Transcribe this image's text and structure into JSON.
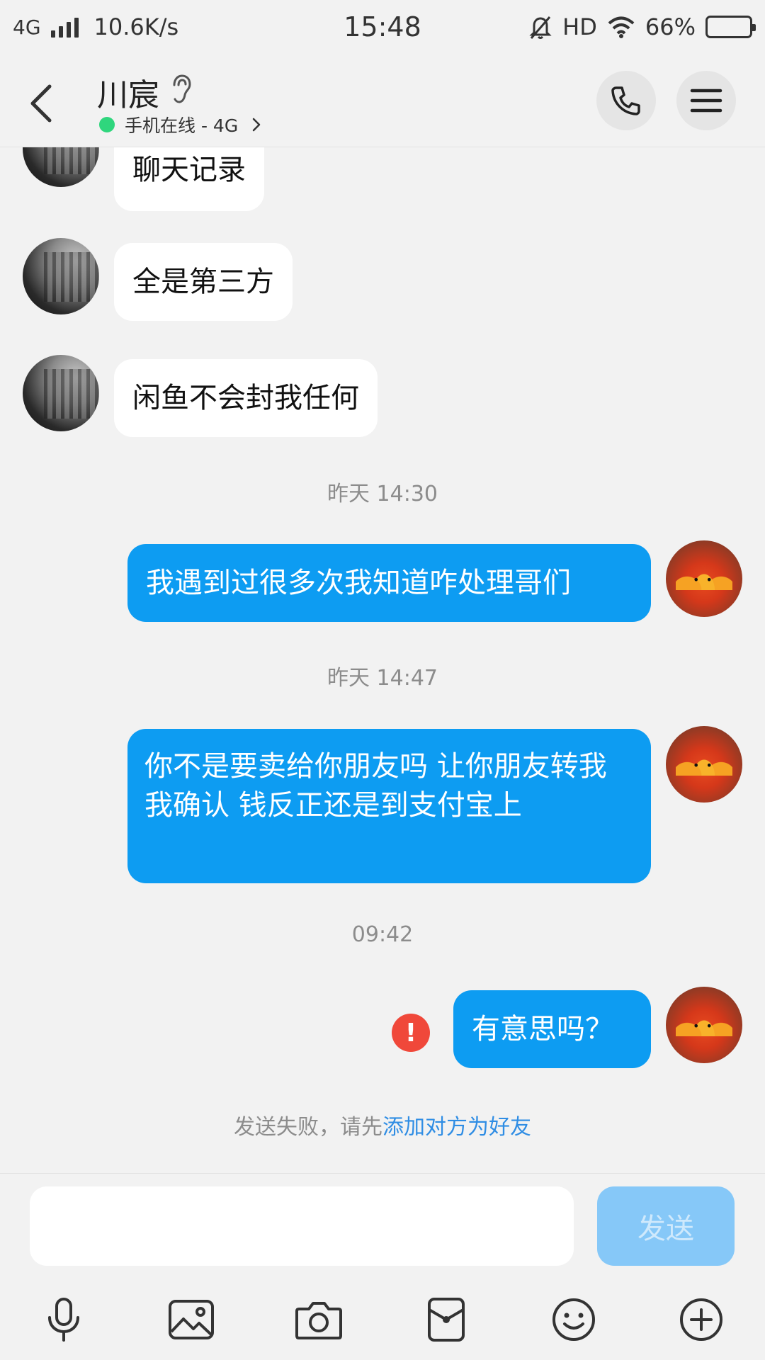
{
  "status_bar": {
    "network": "4G",
    "speed": "10.6K/s",
    "time": "15:48",
    "hd": "HD",
    "battery": "66%",
    "battery_level": 0.66
  },
  "header": {
    "contact_name": "川宸",
    "online_status": "手机在线 - 4G"
  },
  "messages": [
    {
      "side": "in",
      "text": "聊天记录"
    },
    {
      "side": "in",
      "text": "全是第三方"
    },
    {
      "side": "in",
      "text": "闲鱼不会封我任何"
    },
    {
      "type": "time",
      "text": "昨天 14:30"
    },
    {
      "side": "out",
      "text": "我遇到过很多次我知道咋处理哥们"
    },
    {
      "type": "time",
      "text": "昨天 14:47"
    },
    {
      "side": "out",
      "text": "你不是要卖给你朋友吗 让你朋友转我 我确认 钱反正还是到支付宝上"
    },
    {
      "type": "time",
      "text": "09:42"
    },
    {
      "side": "out",
      "text": "有意思吗？",
      "failed": true
    }
  ],
  "failure_notice": {
    "prefix": "发送失败，请先",
    "link": "添加对方为好友"
  },
  "input": {
    "placeholder": "",
    "send_label": "发送"
  },
  "toolbar_icons": [
    "microphone-icon",
    "image-icon",
    "camera-icon",
    "red-packet-icon",
    "emoji-icon",
    "plus-icon"
  ],
  "colors": {
    "outgoing_bubble": "#0d9cf2",
    "incoming_bubble": "#ffffff",
    "online_dot": "#2fd67d",
    "error": "#f0483a",
    "link": "#2f8de4",
    "send_disabled": "#86c8f8"
  }
}
